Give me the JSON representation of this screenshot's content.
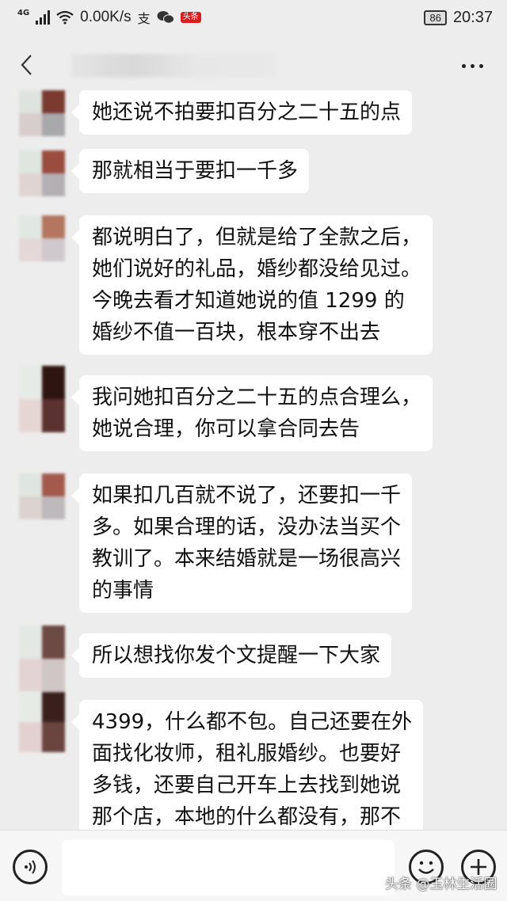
{
  "status_bar": {
    "network": "4G",
    "speed": "0.00K/s",
    "app_badge": "头条",
    "battery": "86",
    "time": "20:37"
  },
  "nav": {
    "back_icon": "chevron-left-icon",
    "more_icon": "more-dots-icon"
  },
  "messages": [
    {
      "text": "她还说不拍要扣百分之二十五的点"
    },
    {
      "text": "那就相当于要扣一千多"
    },
    {
      "text": "都说明白了，但就是给了全款之后，\n她们说好的礼品，婚纱都没给见过。\n今晚去看才知道她说的值 1299 的\n婚纱不值一百块，根本穿不出去"
    },
    {
      "text": "我问她扣百分之二十五的点合理么，\n她说合理，你可以拿合同去告"
    },
    {
      "text": "如果扣几百就不说了，还要扣一千\n多。如果合理的话，没办法当买个\n教训了。本来结婚就是一场很高兴\n的事情"
    },
    {
      "text": "所以想找你发个文提醒一下大家"
    },
    {
      "text": "4399，什么都不包。自己还要在外\n面找化妆师，租礼服婚纱。也要好\n多钱，还要自己开车上去找到她说\n那个店，本地的什么都没有，那不"
    }
  ],
  "input_bar": {
    "voice_icon": "voice-icon",
    "emoji_icon": "emoji-icon",
    "plus_icon": "plus-icon"
  },
  "watermark": "头条 @玉林生活圈",
  "colors": {
    "background": "#ededed",
    "bubble": "#ffffff"
  }
}
